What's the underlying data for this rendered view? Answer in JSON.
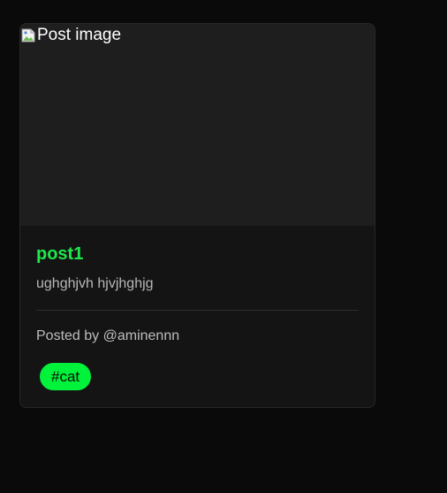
{
  "post": {
    "image_alt": "Post image",
    "title": "post1",
    "description": "ughghjvh hjvjhghjg",
    "author": "Posted by @aminennn",
    "tags": [
      "#cat"
    ]
  },
  "colors": {
    "page_background": "#0a0a0a",
    "card_background": "#141414",
    "image_placeholder": "#1e1e1e",
    "title_accent": "#1ee84b",
    "tag_background": "#00f23a"
  },
  "icons": {
    "image_placeholder": "broken-image-icon"
  }
}
